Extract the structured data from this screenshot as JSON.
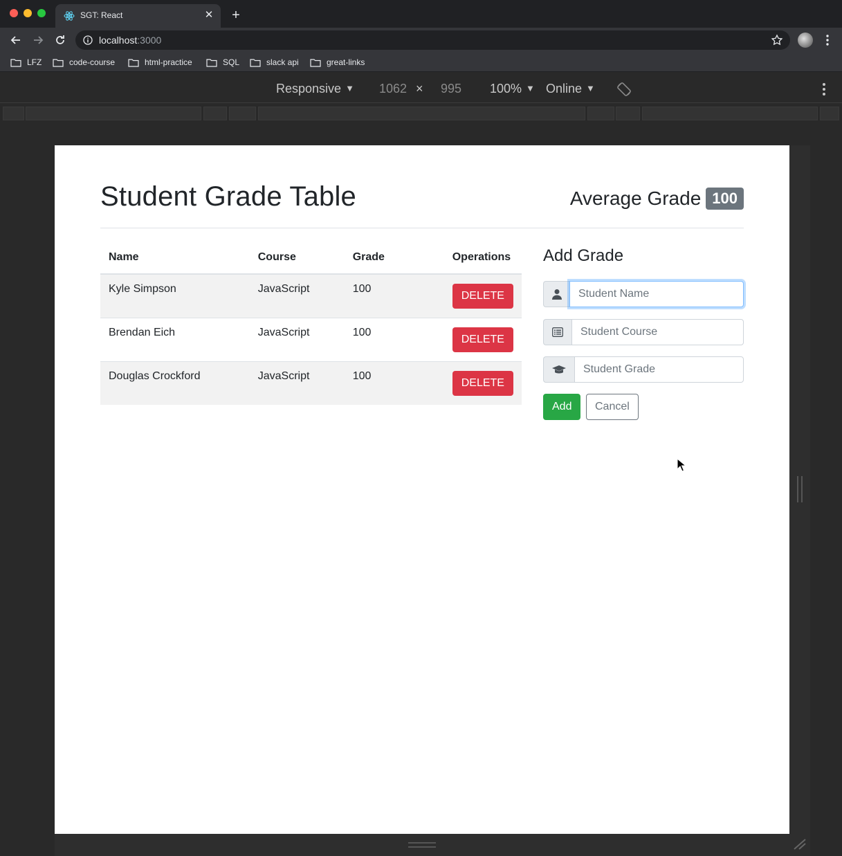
{
  "browser": {
    "tab_title": "SGT: React",
    "new_tab_label": "+",
    "tab_close_label": "✕",
    "url_host": "localhost",
    "url_port": ":3000",
    "bookmarks": [
      "LFZ",
      "code-course",
      "html-practice",
      "SQL",
      "slack api",
      "great-links"
    ]
  },
  "devtools": {
    "device_mode": "Responsive",
    "width": "1062",
    "times": "×",
    "height": "995",
    "zoom": "100%",
    "network": "Online"
  },
  "app": {
    "title": "Student Grade Table",
    "average_label": "Average Grade",
    "average_value": "100",
    "table": {
      "headers": [
        "Name",
        "Course",
        "Grade",
        "Operations"
      ],
      "rows": [
        {
          "name": "Kyle Simpson",
          "course": "JavaScript",
          "grade": "100",
          "action": "DELETE"
        },
        {
          "name": "Brendan Eich",
          "course": "JavaScript",
          "grade": "100",
          "action": "DELETE"
        },
        {
          "name": "Douglas Crockford",
          "course": "JavaScript",
          "grade": "100",
          "action": "DELETE"
        }
      ]
    },
    "form": {
      "title": "Add Grade",
      "name_placeholder": "Student Name",
      "course_placeholder": "Student Course",
      "grade_placeholder": "Student Grade",
      "add_label": "Add",
      "cancel_label": "Cancel"
    }
  },
  "colors": {
    "delete": "#dc3545",
    "add": "#28a745",
    "badge": "#6c757d",
    "focus": "#80bdff"
  }
}
